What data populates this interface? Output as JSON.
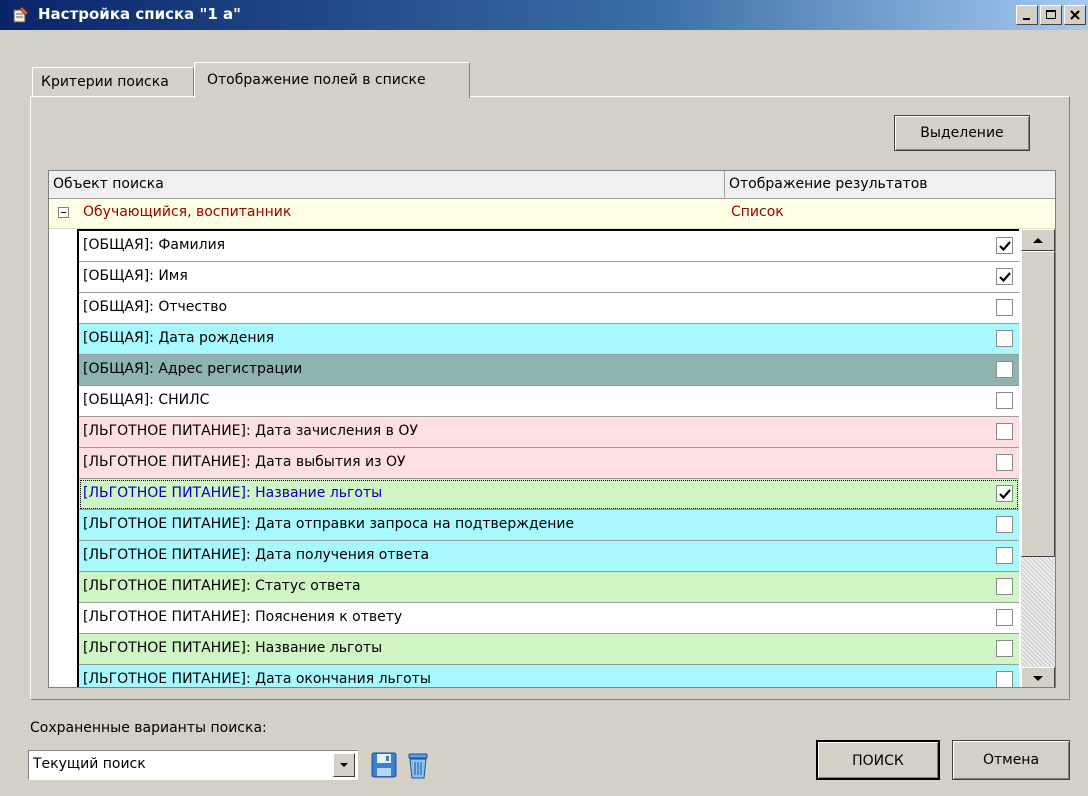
{
  "window": {
    "title": "Настройка списка  \"1 а\""
  },
  "tabs": [
    {
      "label": "Критерии поиска",
      "active": false
    },
    {
      "label": "Отображение полей в списке",
      "active": true
    }
  ],
  "toolbar": {
    "select_label": "Выделение"
  },
  "grid": {
    "columns": [
      "Объект поиска",
      "Отображение результатов"
    ],
    "group": {
      "label": "Обучающийся, воспитанник",
      "value": "Список",
      "expanded": true
    },
    "rows": [
      {
        "label": "[ОБЩАЯ]: Фамилия",
        "checked": true,
        "bg": "#ffffff"
      },
      {
        "label": "[ОБЩАЯ]: Имя",
        "checked": true,
        "bg": "#ffffff"
      },
      {
        "label": "[ОБЩАЯ]: Отчество",
        "checked": false,
        "bg": "#ffffff"
      },
      {
        "label": "[ОБЩАЯ]: Дата рождения",
        "checked": false,
        "bg": "#a8f8ff"
      },
      {
        "label": "[ОБЩАЯ]: Адрес регистрации",
        "checked": false,
        "bg": "#8fb3b0"
      },
      {
        "label": "[ОБЩАЯ]: СНИЛС",
        "checked": false,
        "bg": "#ffffff"
      },
      {
        "label": "[ЛЬГОТНОЕ ПИТАНИЕ]: Дата зачисления в ОУ",
        "checked": false,
        "bg": "#ffe0e0"
      },
      {
        "label": "[ЛЬГОТНОЕ ПИТАНИЕ]: Дата выбытия из ОУ",
        "checked": false,
        "bg": "#ffe0e0"
      },
      {
        "label": "[ЛЬГОТНОЕ ПИТАНИЕ]: Название льготы",
        "checked": true,
        "bg": "#cff5c4",
        "focused": true
      },
      {
        "label": "[ЛЬГОТНОЕ ПИТАНИЕ]: Дата отправки запроса на подтверждение",
        "checked": false,
        "bg": "#a8f8ff"
      },
      {
        "label": "[ЛЬГОТНОЕ ПИТАНИЕ]: Дата получения ответа",
        "checked": false,
        "bg": "#a8f8ff"
      },
      {
        "label": "[ЛЬГОТНОЕ ПИТАНИЕ]: Статус ответа",
        "checked": false,
        "bg": "#cff5c4"
      },
      {
        "label": "[ЛЬГОТНОЕ ПИТАНИЕ]: Пояснения к ответу",
        "checked": false,
        "bg": "#ffffff"
      },
      {
        "label": "[ЛЬГОТНОЕ ПИТАНИЕ]: Название льготы",
        "checked": false,
        "bg": "#cff5c4"
      },
      {
        "label": "[ЛЬГОТНОЕ ПИТАНИЕ]: Дата окончания льготы",
        "checked": false,
        "bg": "#a8f8ff"
      },
      {
        "label": "",
        "checked": false,
        "bg": "#ffffff"
      }
    ]
  },
  "saved": {
    "label": "Сохраненные варианты поиска:",
    "selected": "Текущий поиск"
  },
  "actions": {
    "search_label": "ПОИСК",
    "cancel_label": "Отмена"
  },
  "colors": {
    "focus_text": "#0000c0",
    "group_text": "#a00000"
  }
}
